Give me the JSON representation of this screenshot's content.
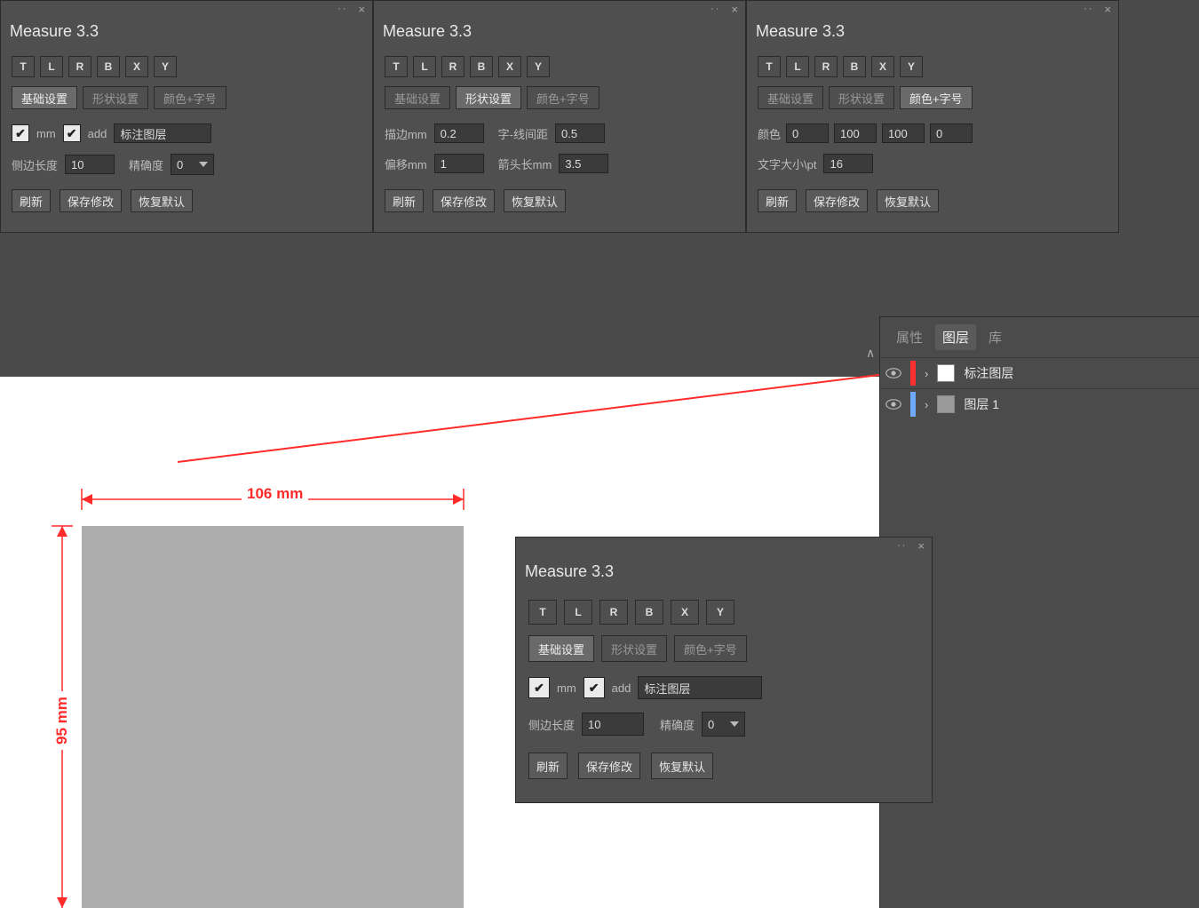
{
  "panel_title": "Measure 3.3",
  "dir_buttons": [
    "T",
    "L",
    "R",
    "B",
    "X",
    "Y"
  ],
  "tabs": {
    "basic": "基础设置",
    "shape": "形状设置",
    "colorfont": "颜色+字号"
  },
  "cb": {
    "mm": "mm",
    "add": "add"
  },
  "layer_name_value": "标注图层",
  "side_len_label": "侧边长度",
  "side_len_value": "10",
  "precision_label": "精确度",
  "precision_value": "0",
  "btns": {
    "refresh": "刷新",
    "save": "保存修改",
    "reset": "恢复默认"
  },
  "shape": {
    "stroke_label": "描边mm",
    "stroke_value": "0.2",
    "gap_label": "字-线间距",
    "gap_value": "0.5",
    "offset_label": "偏移mm",
    "offset_value": "1",
    "arrow_label": "箭头长mm",
    "arrow_value": "3.5"
  },
  "colorfont": {
    "color_label": "颜色",
    "c0": "0",
    "c1": "100",
    "c2": "100",
    "c3": "0",
    "font_label": "文字大小\\pt",
    "font_value": "16"
  },
  "canvas": {
    "width_label": "106 mm",
    "height_label": "95 mm"
  },
  "layers": {
    "tabs": {
      "props": "属性",
      "layers": "图层",
      "lib": "库"
    },
    "row1": "标注图层",
    "row2": "图层 1"
  }
}
